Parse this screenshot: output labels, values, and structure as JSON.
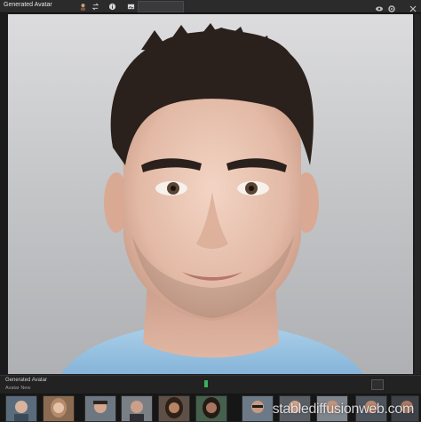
{
  "app": {
    "title": "Generated Avatar"
  },
  "toolbar": {
    "icons": [
      "avatar-icon",
      "swap-icon",
      "info-icon",
      "image-icon"
    ]
  },
  "status": {
    "title": "Generated Avatar",
    "subtitle": "Avatar New"
  },
  "filmstrip": {
    "thumbnail_count": 11
  },
  "watermark": {
    "text": "stablediffusionweb.com"
  },
  "colors": {
    "accent_progress": "#3fae5a",
    "shirt": "#9dc6e6",
    "background_top": "#dcdcde",
    "background_bottom": "#aeb0b3"
  }
}
